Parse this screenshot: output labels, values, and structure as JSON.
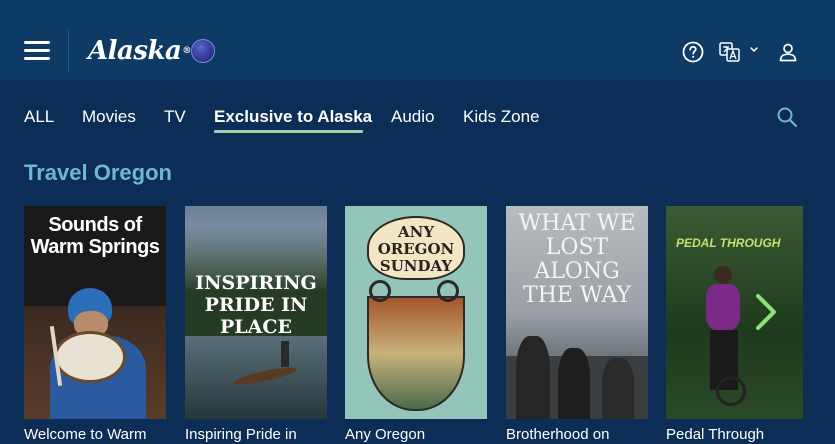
{
  "header": {
    "logo_text": "Alaska",
    "logo_mark": "®",
    "menu_icon": "hamburger-menu-icon",
    "help_icon": "question-circle-icon",
    "language_icon": "language-translate-icon",
    "account_icon": "user-icon"
  },
  "nav": {
    "tabs": [
      {
        "label": "ALL"
      },
      {
        "label": "Movies"
      },
      {
        "label": "TV"
      },
      {
        "label": "Exclusive to Alaska"
      },
      {
        "label": "Audio"
      },
      {
        "label": "Kids Zone"
      }
    ],
    "active_tab": "Exclusive to Alaska",
    "search_icon": "search-icon"
  },
  "section": {
    "title": "Travel Oregon"
  },
  "cards": [
    {
      "title": "Welcome to Warm",
      "poster_text": "Sounds of Warm Springs"
    },
    {
      "title": "Inspiring Pride in",
      "poster_text": "INSPIRING PRIDE IN PLACE"
    },
    {
      "title": "Any Oregon",
      "poster_text": "ANY OREGON SUNDAY"
    },
    {
      "title": "Brotherhood on",
      "poster_text": "WHAT WE LOST ALONG THE WAY"
    },
    {
      "title": "Pedal Through",
      "poster_text": "PEDAL THROUGH"
    }
  ],
  "colors": {
    "background": "#0c2d55",
    "header": "#0e3a66",
    "accent_underline": "#9bd0a4",
    "section_title": "#6eb6d8",
    "carousel_arrow": "#8fe07a"
  }
}
